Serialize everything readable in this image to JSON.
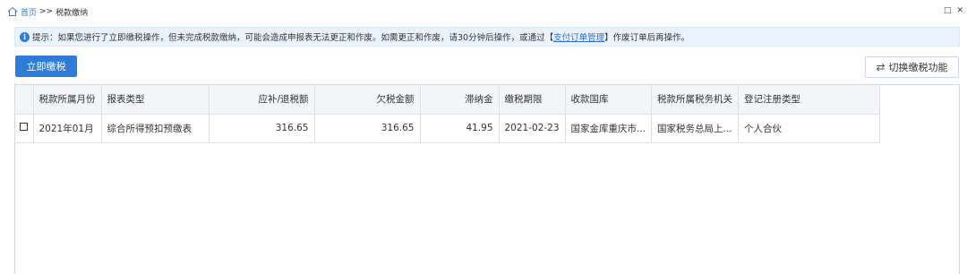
{
  "breadcrumb": {
    "home": "首页",
    "separator": ">>",
    "current": "税款缴纳"
  },
  "window_controls": {
    "restore": "□",
    "close": "✕"
  },
  "notice": {
    "prefix": "提示：如果您进行了立即缴税操作，但未完成税款缴纳，可能会造成申报表无法更正和作废。如需更正和作废，请30分钟后操作，或通过【",
    "link": "支付订单管理",
    "suffix": "】作废订单后再操作。"
  },
  "buttons": {
    "pay_now": "立即缴税",
    "switch_function": "切换缴税功能"
  },
  "table": {
    "headers": [
      "税款所属月份",
      "报表类型",
      "应补/退税额",
      "欠税金额",
      "滞纳金",
      "缴税期限",
      "收款国库",
      "税款所属税务机关",
      "登记注册类型"
    ],
    "rows": [
      [
        "2021年01月",
        "综合所得预扣预缴表",
        "316.65",
        "316.65",
        "41.95",
        "2021-02-23",
        "国家金库重庆市...",
        "国家税务总局上...",
        "个人合伙"
      ]
    ]
  },
  "colors": {
    "accent": "#2f7bd8",
    "notice_bg": "#eaf3fd"
  },
  "icons": {
    "home": "home-icon",
    "info": "info-icon",
    "swap": "swap-icon"
  }
}
